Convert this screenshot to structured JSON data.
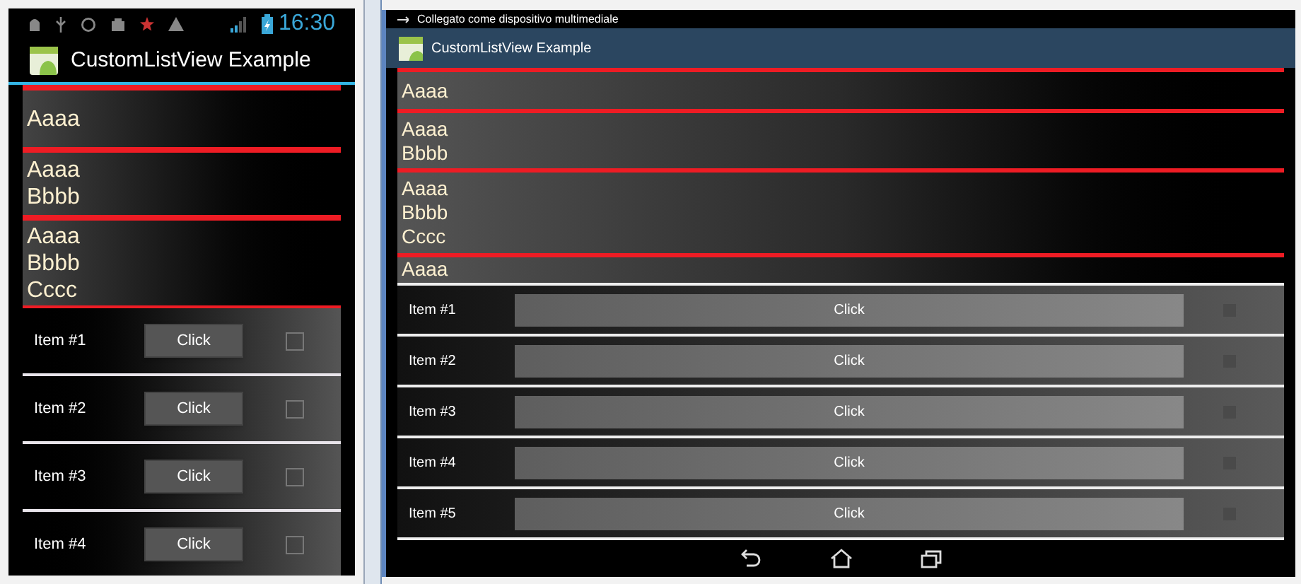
{
  "phone": {
    "status_bar": {
      "time": "16:30"
    },
    "app_title": "CustomListView Example",
    "text_rows": [
      {
        "lines": [
          "Aaaa"
        ]
      },
      {
        "lines": [
          "Aaaa",
          "Bbbb"
        ]
      },
      {
        "lines": [
          "Aaaa",
          "Bbbb",
          "Cccc"
        ]
      }
    ],
    "items": [
      {
        "label": "Item #1",
        "button": "Click",
        "checked": false
      },
      {
        "label": "Item #2",
        "button": "Click",
        "checked": false
      },
      {
        "label": "Item #3",
        "button": "Click",
        "checked": false
      },
      {
        "label": "Item #4",
        "button": "Click",
        "checked": false
      }
    ]
  },
  "tablet": {
    "status_bar": {
      "notification": "Collegato come dispositivo multimediale"
    },
    "app_title": "CustomListView Example",
    "text_rows": [
      {
        "lines": [
          "Aaaa"
        ]
      },
      {
        "lines": [
          "Aaaa",
          "Bbbb"
        ]
      },
      {
        "lines": [
          "Aaaa",
          "Bbbb",
          "Cccc"
        ]
      },
      {
        "lines": [
          "Aaaa"
        ]
      }
    ],
    "items": [
      {
        "label": "Item #1",
        "button": "Click",
        "checked": false
      },
      {
        "label": "Item #2",
        "button": "Click",
        "checked": false
      },
      {
        "label": "Item #3",
        "button": "Click",
        "checked": false
      },
      {
        "label": "Item #4",
        "button": "Click",
        "checked": false
      },
      {
        "label": "Item #5",
        "button": "Click",
        "checked": false
      }
    ]
  }
}
